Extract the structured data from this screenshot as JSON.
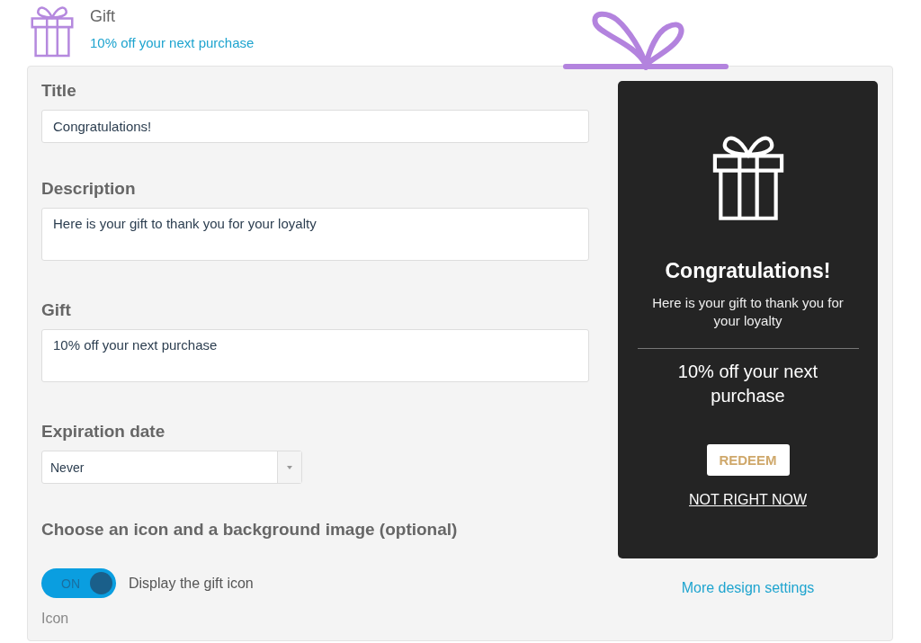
{
  "header": {
    "title": "Gift",
    "subtitle": "10% off your next purchase"
  },
  "form": {
    "fields": [
      {
        "label": "Title",
        "value": "Congratulations!",
        "kind": "input"
      },
      {
        "label": "Description",
        "value": "Here is your gift to thank you for your loyalty",
        "kind": "textarea"
      },
      {
        "label": "Gift",
        "value": "10% off your next purchase",
        "kind": "textarea"
      },
      {
        "label": "Expiration date",
        "value": "Never",
        "kind": "select"
      }
    ],
    "section_title": "Choose an icon and a background image (optional)",
    "toggle": {
      "state_label": "ON",
      "on": true,
      "label": "Display the gift icon"
    },
    "icon_label": "Icon"
  },
  "preview": {
    "title": "Congratulations!",
    "description": "Here is your gift to thank you for your loyalty",
    "gift": "10% off your next purchase",
    "redeem": "REDEEM",
    "dismiss": "NOT RIGHT NOW"
  },
  "more_link": "More design settings"
}
